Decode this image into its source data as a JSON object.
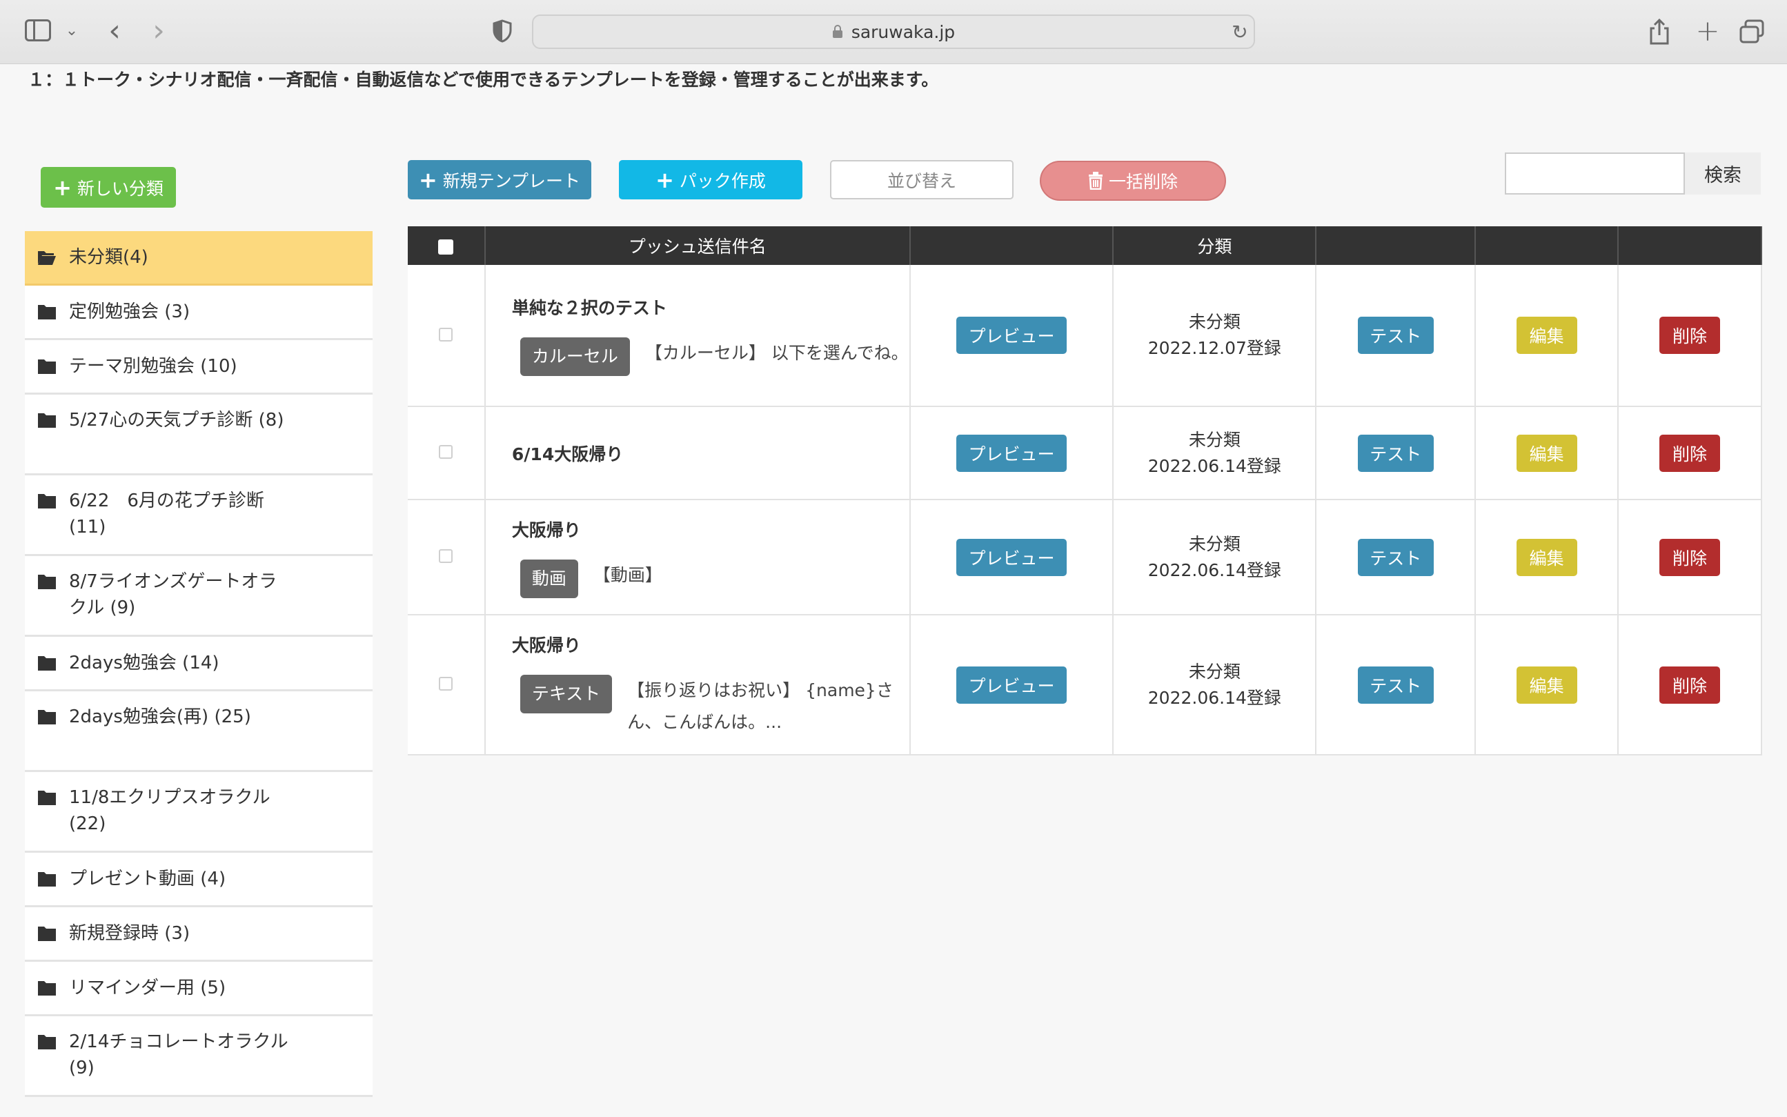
{
  "browser": {
    "url": "saruwaka.jp"
  },
  "page": {
    "description": "１：１トーク・シナリオ配信・一斉配信・自動返信などで使用できるテンプレートを登録・管理することが出来ます。"
  },
  "toolbar": {
    "new_category": "新しい分類",
    "new_template": "新規テンプレート",
    "pack_create": "パック作成",
    "sort": "並び替え",
    "bulk_delete": "一括削除",
    "search_placeholder": "",
    "search_button": "検索"
  },
  "categories": [
    {
      "label": "未分類(4)",
      "active": true
    },
    {
      "label": "定例勉強会 (3)"
    },
    {
      "label": "テーマ別勉強会 (10)"
    },
    {
      "label": "5/27心の天気プチ診断 (8)"
    },
    {
      "label": "6/22　6月の花プチ診断 (11)"
    },
    {
      "label": "8/7ライオンズゲートオラクル (9)"
    },
    {
      "label": "2days勉強会 (14)"
    },
    {
      "label": "2days勉強会(再) (25)"
    },
    {
      "label": "11/8エクリプスオラクル (22)"
    },
    {
      "label": "プレゼント動画 (4)"
    },
    {
      "label": "新規登録時 (3)"
    },
    {
      "label": "リマインダー用 (5)"
    },
    {
      "label": "2/14チョコレートオラクル (9)"
    }
  ],
  "table": {
    "headers": {
      "name": "プッシュ送信件名",
      "category": "分類"
    },
    "actions": {
      "preview": "プレビュー",
      "test": "テスト",
      "edit": "編集",
      "delete": "削除"
    },
    "rows": [
      {
        "name": "単純な２択のテスト",
        "type": "カルーセル",
        "text": "【カルーセル】 以下を選んでね。",
        "category": "未分類",
        "date": "2022.12.07登録"
      },
      {
        "name": "6/14大阪帰り",
        "type": "",
        "text": "",
        "category": "未分類",
        "date": "2022.06.14登録"
      },
      {
        "name": "大阪帰り",
        "type": "動画",
        "text": "【動画】",
        "category": "未分類",
        "date": "2022.06.14登録"
      },
      {
        "name": "大阪帰り",
        "type": "テキスト",
        "text": "【振り返りはお祝い】 {name}さん、こんばんは。...",
        "category": "未分類",
        "date": "2022.06.14登録"
      }
    ]
  }
}
